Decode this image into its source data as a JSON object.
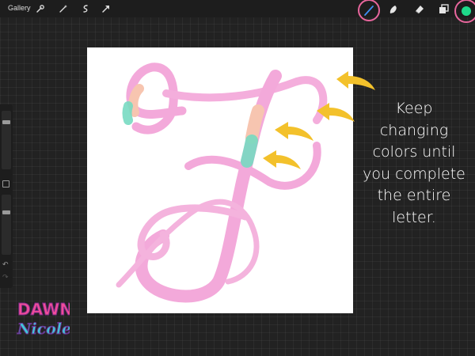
{
  "toolbar": {
    "gallery_label": "Gallery",
    "left_icons": [
      "wrench-icon",
      "magic-wand-icon",
      "selection-icon",
      "move-arrow-icon"
    ],
    "right_icons": [
      "brush-icon",
      "smudge-icon",
      "eraser-icon",
      "layers-icon",
      "color-picker-icon"
    ],
    "active_tool": "brush-icon",
    "current_color": "#1ed98a"
  },
  "sidebar": {
    "sliders": [
      "brush-size-slider",
      "opacity-slider"
    ],
    "buttons": [
      "modify-square-button",
      "undo-button",
      "redo-button"
    ]
  },
  "canvas": {
    "background": "#ffffff",
    "artwork": "pink watercolor lettering of capital F with peach and teal color bands",
    "colors": {
      "pink": "#f29bd4",
      "peach": "#f6bca3",
      "teal": "#5fd4b7",
      "arrow": "#f3c12b"
    }
  },
  "caption": {
    "lines": [
      "Keep",
      "changing",
      "colors until",
      "you complete",
      "the entire",
      "letter."
    ]
  },
  "logo": {
    "line1": "DAWN",
    "line2": "Nicole"
  }
}
